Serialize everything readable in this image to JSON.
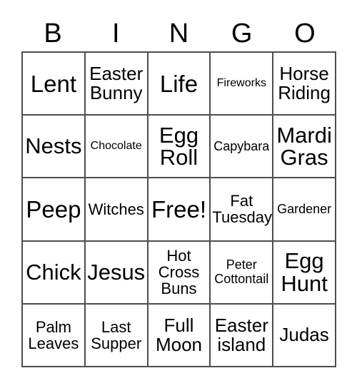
{
  "card": {
    "title_letters": [
      "B",
      "I",
      "N",
      "G",
      "O"
    ],
    "free_space_label": "Free!",
    "columns": 5,
    "rows": 5,
    "text_color": "#000000",
    "border_color": "#4d4d4d",
    "background_color": "#ffffff",
    "rows_data": [
      [
        "Lent",
        "Easter Bunny",
        "Life",
        "Fireworks",
        "Horse Riding"
      ],
      [
        "Nests",
        "Chocolate",
        "Egg Roll",
        "Capybara",
        "Mardi Gras"
      ],
      [
        "Peep",
        "Witches",
        "Free!",
        "Fat Tuesday",
        "Gardener"
      ],
      [
        "Chick",
        "Jesus",
        "Hot Cross Buns",
        "Peter Cottontail",
        "Egg Hunt"
      ],
      [
        "Palm Leaves",
        "Last Supper",
        "Full Moon",
        "Easter island",
        "Judas"
      ]
    ],
    "cell_sizes": [
      [
        "sz-xl",
        "sz-md",
        "sz-xl",
        "sz-xxs",
        "sz-md"
      ],
      [
        "sz-lg",
        "sz-xxs",
        "sz-lg",
        "sz-xs",
        "sz-lg"
      ],
      [
        "sz-xl",
        "sz-sm",
        "sz-xl",
        "sz-sm",
        "sz-xs"
      ],
      [
        "sz-lg",
        "sz-lg",
        "sz-sm",
        "sz-xs",
        "sz-lg"
      ],
      [
        "sz-sm",
        "sz-sm",
        "sz-md",
        "sz-md",
        "sz-md"
      ]
    ]
  }
}
